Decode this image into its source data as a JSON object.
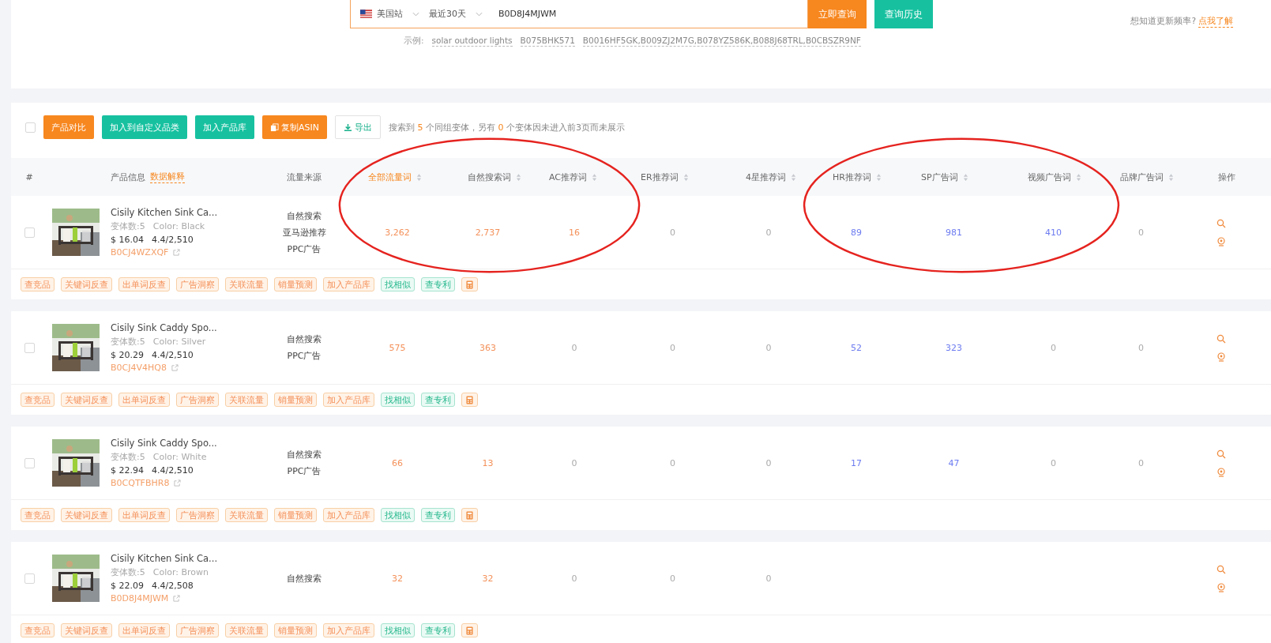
{
  "search": {
    "site": "美国站",
    "period": "最近30天",
    "value": "B0D8J4MJWM",
    "buttons": [
      {
        "label": "立即查询",
        "kind": "orange"
      },
      {
        "label": "查询历史",
        "kind": "teal"
      }
    ],
    "examples_label": "示例:",
    "examples": [
      "solar outdoor lights",
      "B075BHK571",
      "B0016HF5GK,B009ZJ2M7G,B078YZ586K,B088J68TRL,B0CBSZR9NF"
    ],
    "help_text": "想知道更新频率?",
    "help_link": "点我了解"
  },
  "toolbar": {
    "select_all": false,
    "buttons": [
      {
        "label": "产品对比",
        "kind": "orange"
      },
      {
        "label": "加入到自定义品类",
        "kind": "teal"
      },
      {
        "label": "加入产品库",
        "kind": "teal"
      },
      {
        "label": "复制ASIN",
        "kind": "copy"
      },
      {
        "label": "导出",
        "kind": "export"
      }
    ],
    "summary": [
      "搜索到 ",
      "5",
      " 个同组变体，另有 ",
      "0",
      " 个变体因未进入前3页而未展示"
    ]
  },
  "table": {
    "index_header": "#",
    "product_header": "产品信息",
    "product_header_link": "数据解释",
    "source_header": "流量来源",
    "action_header": "操作",
    "columns": [
      {
        "label": "全部流量词",
        "selected": true,
        "color": "#f4915a",
        "circled": true
      },
      {
        "label": "自然搜索词",
        "selected": false,
        "color": "#f4915a",
        "circled": true
      },
      {
        "label": "AC推荐词",
        "selected": false,
        "color": "#f4915a",
        "circled": true
      },
      {
        "label": "ER推荐词",
        "selected": false,
        "circled": false
      },
      {
        "label": "4星推荐词",
        "selected": false,
        "circled": false
      },
      {
        "label": "HR推荐词",
        "selected": false,
        "color": "#6d7cf0",
        "circled": true
      },
      {
        "label": "SP广告词",
        "selected": false,
        "color": "#6d7cf0",
        "circled": true
      },
      {
        "label": "视频广告词",
        "selected": false,
        "color": "#6d7cf0",
        "circled": true
      },
      {
        "label": "品牌广告词",
        "selected": false,
        "circled": false
      }
    ],
    "rows": [
      {
        "checked": false,
        "title": "Cisily Kitchen Sink Ca...",
        "variants": "变体数:5",
        "color_label": "Color: Black",
        "price": "$ 16.04",
        "rating": "4.4/2,510",
        "asin": "B0CJ4WZXQF",
        "sources": [
          "自然搜索",
          "亚马逊推荐",
          "PPC广告"
        ],
        "metrics": [
          "3,262",
          "2,737",
          "16",
          "0",
          "0",
          "89",
          "981",
          "410",
          "0"
        ],
        "tags": [
          {
            "label": "查竞品",
            "kind": "orange"
          },
          {
            "label": "关键词反查",
            "kind": "orange"
          },
          {
            "label": "出单词反查",
            "kind": "orange"
          },
          {
            "label": "广告洞察",
            "kind": "orange"
          },
          {
            "label": "关联流量",
            "kind": "orange"
          },
          {
            "label": "销量预测",
            "kind": "orange"
          },
          {
            "label": "加入产品库",
            "kind": "orange"
          },
          {
            "label": "找相似",
            "kind": "green"
          },
          {
            "label": "查专利",
            "kind": "green"
          },
          {
            "kind": "calculator"
          }
        ]
      },
      {
        "checked": false,
        "title": "Cisily Sink Caddy Spo...",
        "variants": "变体数:5",
        "color_label": "Color: Silver",
        "price": "$ 20.29",
        "rating": "4.4/2,510",
        "asin": "B0CJ4V4HQ8",
        "sources": [
          "自然搜索",
          "PPC广告"
        ],
        "metrics": [
          "575",
          "363",
          "0",
          "0",
          "0",
          "52",
          "323",
          "0",
          "0"
        ],
        "tags": [
          {
            "label": "查竞品",
            "kind": "orange"
          },
          {
            "label": "关键词反查",
            "kind": "orange"
          },
          {
            "label": "出单词反查",
            "kind": "orange"
          },
          {
            "label": "广告洞察",
            "kind": "orange"
          },
          {
            "label": "关联流量",
            "kind": "orange"
          },
          {
            "label": "销量预测",
            "kind": "orange"
          },
          {
            "label": "加入产品库",
            "kind": "orange"
          },
          {
            "label": "找相似",
            "kind": "green"
          },
          {
            "label": "查专利",
            "kind": "green"
          },
          {
            "kind": "calculator"
          }
        ]
      },
      {
        "checked": false,
        "title": "Cisily Sink Caddy Spo...",
        "variants": "变体数:5",
        "color_label": "Color: White",
        "price": "$ 22.94",
        "rating": "4.4/2,510",
        "asin": "B0CQTFBHR8",
        "sources": [
          "自然搜索",
          "PPC广告"
        ],
        "metrics": [
          "66",
          "13",
          "0",
          "0",
          "0",
          "17",
          "47",
          "0",
          "0"
        ],
        "tags": [
          {
            "label": "查竞品",
            "kind": "orange"
          },
          {
            "label": "关键词反查",
            "kind": "orange"
          },
          {
            "label": "出单词反查",
            "kind": "orange"
          },
          {
            "label": "广告洞察",
            "kind": "orange"
          },
          {
            "label": "关联流量",
            "kind": "orange"
          },
          {
            "label": "销量预测",
            "kind": "orange"
          },
          {
            "label": "加入产品库",
            "kind": "orange"
          },
          {
            "label": "找相似",
            "kind": "green"
          },
          {
            "label": "查专利",
            "kind": "green"
          },
          {
            "kind": "calculator"
          }
        ]
      },
      {
        "checked": false,
        "title": "Cisily Kitchen Sink Ca...",
        "variants": "变体数:5",
        "color_label": "Color: Brown",
        "price": "$ 22.09",
        "rating": "4.4/2,508",
        "asin": "B0D8J4MJWM",
        "sources": [
          "自然搜索"
        ],
        "metrics": [
          "32",
          "32",
          "0",
          "0",
          "0"
        ],
        "tags": [
          {
            "label": "查竞品",
            "kind": "orange"
          },
          {
            "label": "关键词反查",
            "kind": "orange"
          },
          {
            "label": "出单词反查",
            "kind": "orange"
          },
          {
            "label": "广告洞察",
            "kind": "orange"
          },
          {
            "label": "关联流量",
            "kind": "orange"
          },
          {
            "label": "销量预测",
            "kind": "orange"
          },
          {
            "label": "加入产品库",
            "kind": "orange"
          },
          {
            "label": "找相似",
            "kind": "green"
          },
          {
            "label": "查专利",
            "kind": "green"
          },
          {
            "kind": "calculator"
          }
        ]
      }
    ]
  }
}
